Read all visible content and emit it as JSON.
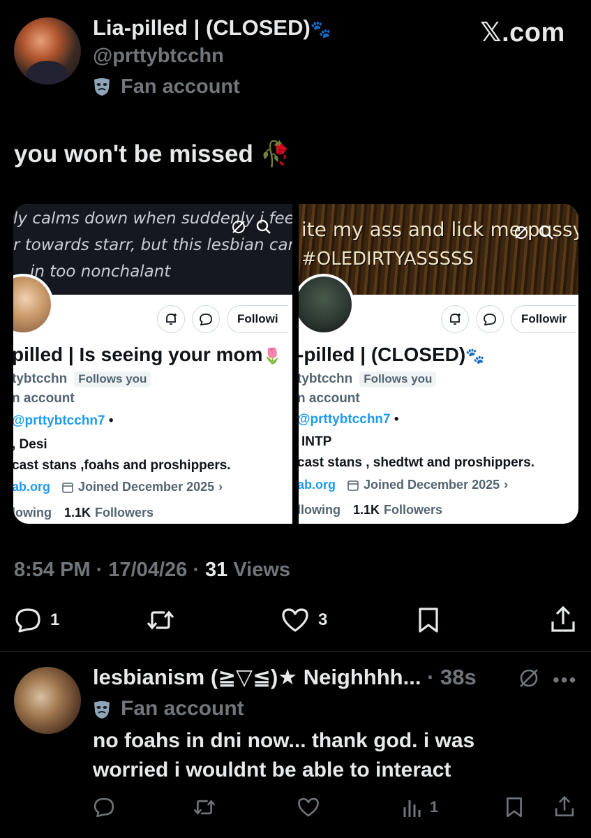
{
  "header": {
    "display_name": "Lia-pilled | (CLOSED)",
    "handle": "@prttybtcchn",
    "account_label": "Fan account",
    "watermark": "𝕏.com",
    "paw_emoji": "🐾"
  },
  "post": {
    "text": "you won't be missed",
    "emoji": "🥀",
    "timestamp": "8:54 PM · 17/04/26 · ",
    "views_count": "31",
    "views_label": " Views",
    "actions": {
      "replies": "1",
      "retweets": "",
      "likes": "3"
    }
  },
  "images": {
    "left": {
      "banner_lines": [
        "ly calms down when suddenly i feel a he",
        "r towards starr, but this lesbian cant rag",
        "in too nonchalant"
      ],
      "follow_label": "Followi",
      "name": "pilled | Is seeing your mom",
      "name_emoji": "🌷",
      "handle": "tybtcchn",
      "follows_you": "Follows you",
      "account": "n account",
      "link_handle": "@prttybtcchn7",
      "bullet": " •",
      "line_desi": ", Desi",
      "dni": "cast stans ,foahs and proshippers.",
      "site": "ab.org",
      "joined": "Joined December 2025",
      "following_label": "lowing",
      "followers_count": "1.1K",
      "followers_label": "Followers"
    },
    "right": {
      "banner_lines": [
        "ite my ass and lick me pussy",
        "#OLEDIRTYASSSSS"
      ],
      "follow_label": "Followir",
      "name": "-pilled | (CLOSED)",
      "name_emoji": "🐾",
      "handle": "tybtcchn",
      "follows_you": "Follows you",
      "account": "n account",
      "link_handle": "@prttybtcchn7",
      "bullet": " •",
      "line_intp": "INTP",
      "dni": "cast stans , shedtwt and proshippers.",
      "site": "ab.org",
      "joined": "Joined December 2025",
      "following_label": "llowing",
      "followers_count": "1.1K",
      "followers_label": "Followers"
    }
  },
  "reply": {
    "display_name": "lesbianism (≧▽≦)★ Neighhhh...",
    "time": " · 38s",
    "account_label": "Fan account",
    "text_line1": "no foahs in dni now... thank god. i was",
    "text_line2": "worried i wouldnt be able to interact",
    "actions": {
      "views": "1"
    }
  }
}
